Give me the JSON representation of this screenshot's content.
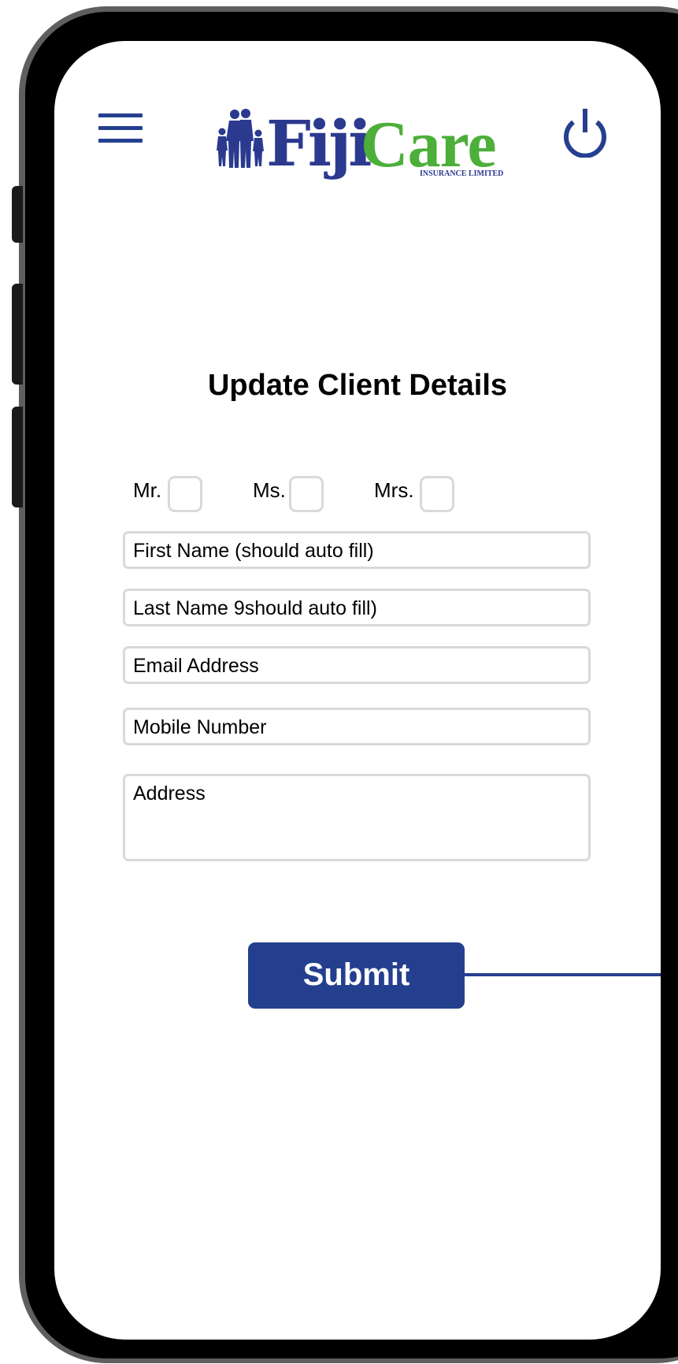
{
  "header": {
    "logo": {
      "fiji": "Fiji",
      "care": "Care",
      "subtitle": "INSURANCE LIMITED"
    },
    "menu_icon": "hamburger-menu-icon",
    "power_icon": "power-icon"
  },
  "form": {
    "title": "Update Client Details",
    "salutations": [
      "Mr.",
      "Ms.",
      "Mrs."
    ],
    "first_name_placeholder": "First Name (should auto fill)",
    "last_name_placeholder": "Last Name 9should auto fill)",
    "email_placeholder": "Email Address",
    "mobile_placeholder": "Mobile Number",
    "address_placeholder": "Address",
    "submit_label": "Submit"
  },
  "colors": {
    "brand_blue": "#253f8f",
    "brand_green": "#4caf3a",
    "field_border": "#d9d9d9"
  }
}
